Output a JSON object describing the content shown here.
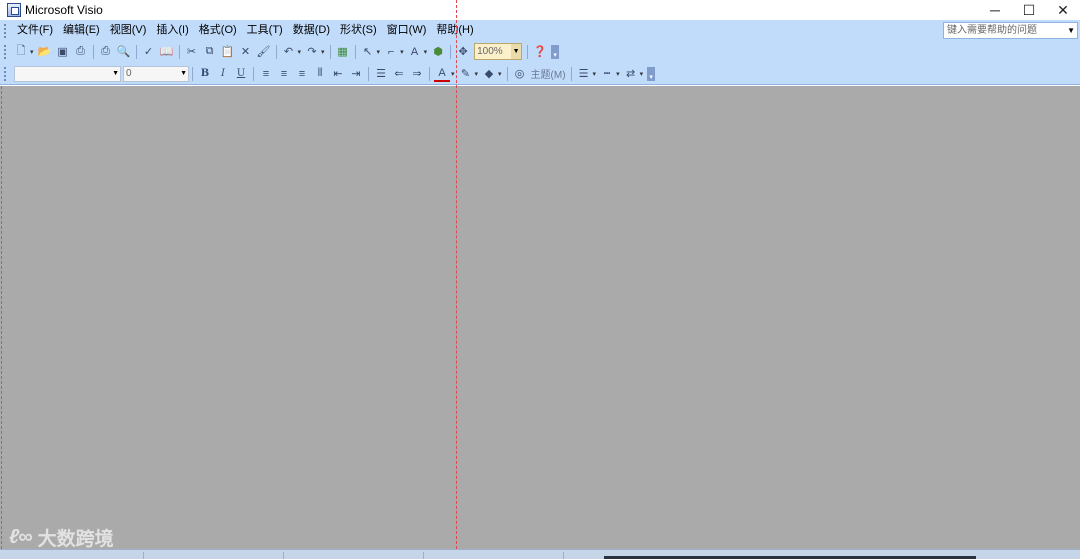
{
  "window": {
    "title": "Microsoft Visio",
    "minimize_glyph": "─",
    "maximize_glyph": "☐",
    "close_glyph": "✕"
  },
  "menubar": {
    "items": [
      {
        "label": "文件(F)"
      },
      {
        "label": "编辑(E)"
      },
      {
        "label": "视图(V)"
      },
      {
        "label": "插入(I)"
      },
      {
        "label": "格式(O)"
      },
      {
        "label": "工具(T)"
      },
      {
        "label": "数据(D)"
      },
      {
        "label": "形状(S)"
      },
      {
        "label": "窗口(W)"
      },
      {
        "label": "帮助(H)"
      }
    ],
    "help_placeholder": "键入需要帮助的问题"
  },
  "standard_toolbar": {
    "icons": [
      "new-icon",
      "open-icon",
      "save-icon",
      "permission-icon",
      "print-icon",
      "print-preview-icon",
      "spelling-icon",
      "research-icon",
      "cut-icon",
      "copy-icon",
      "paste-icon",
      "delete-icon",
      "format-painter-icon",
      "undo-icon",
      "redo-icon",
      "shapes-icon",
      "pointer-tool-icon",
      "connector-tool-icon",
      "text-tool-icon",
      "ink-icon",
      "pan-zoom-icon",
      "help-icon"
    ],
    "zoom_value": "100%"
  },
  "formatting_toolbar": {
    "font_value": "",
    "font_size_value": "0",
    "bold_label": "B",
    "italic_label": "I",
    "underline_label": "U",
    "theme_label": "主题(M)"
  },
  "watermark": {
    "logo": "ℓ∞",
    "text": "大数跨境"
  },
  "colors": {
    "band": "#c1dcfb",
    "workspace": "#aaaaaa",
    "guide_red": "#e04850",
    "guide_blue": "#5b78d0"
  }
}
